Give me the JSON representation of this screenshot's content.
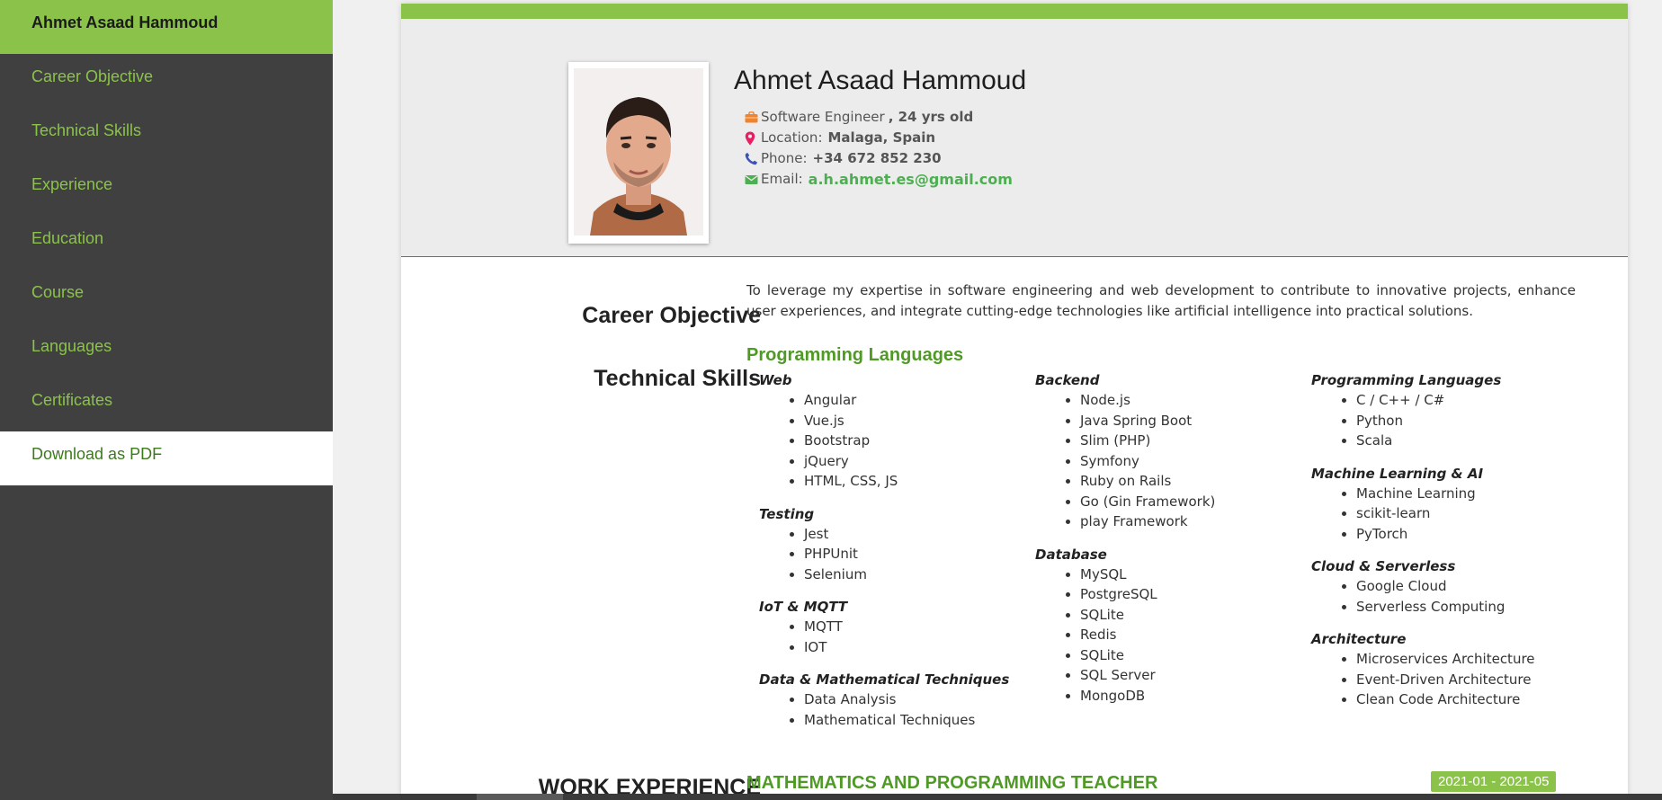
{
  "sidebar": {
    "items": [
      {
        "label": "Ahmet Asaad Hammoud"
      },
      {
        "label": "Career Objective"
      },
      {
        "label": "Technical Skills"
      },
      {
        "label": "Experience"
      },
      {
        "label": "Education"
      },
      {
        "label": "Course"
      },
      {
        "label": "Languages"
      },
      {
        "label": "Certificates"
      },
      {
        "label": "Download as PDF"
      }
    ]
  },
  "profile": {
    "name": "Ahmet Asaad Hammoud",
    "job": "Software Engineer",
    "age": ", 24 yrs old",
    "location_label": "Location:",
    "location": "Malaga, Spain",
    "phone_label": "Phone:",
    "phone": "+34 672 852 230",
    "email_label": "Email:",
    "email": "a.h.ahmet.es@gmail.com"
  },
  "sections": {
    "career_title": "Career Objective",
    "career_text": "To leverage my expertise in software engineering and web development to contribute to innovative projects, enhance user experiences, and integrate cutting-edge technologies like artificial intelligence into practical solutions.",
    "skills_title": "Technical Skills",
    "skills_sub": "Programming Languages",
    "work_title": "WORK EXPERIENCE",
    "job_title": "MATHEMATICS AND PROGRAMMING TEACHER",
    "job_dates": "2021-01 - 2021-05"
  },
  "skills": {
    "col1": [
      {
        "title": "Web",
        "items": [
          "Angular",
          "Vue.js",
          "Bootstrap",
          "jQuery",
          "HTML, CSS, JS"
        ]
      },
      {
        "title": "Testing",
        "items": [
          "Jest",
          "PHPUnit",
          "Selenium"
        ]
      },
      {
        "title": "IoT & MQTT",
        "items": [
          "MQTT",
          "IOT"
        ]
      },
      {
        "title": "Data & Mathematical Techniques",
        "items": [
          "Data Analysis",
          "Mathematical Techniques"
        ]
      }
    ],
    "col2": [
      {
        "title": "Backend",
        "items": [
          "Node.js",
          "Java Spring Boot",
          "Slim (PHP)",
          "Symfony",
          "Ruby on Rails",
          "Go (Gin Framework)",
          "play Framework"
        ]
      },
      {
        "title": "Database",
        "items": [
          "MySQL",
          "PostgreSQL",
          "SQLite",
          "Redis",
          "SQLite",
          "SQL Server",
          "MongoDB"
        ]
      }
    ],
    "col3": [
      {
        "title": "Programming Languages",
        "items": [
          "C / C++ / C#",
          "Python",
          "Scala"
        ]
      },
      {
        "title": "Machine Learning & AI",
        "items": [
          "Machine Learning",
          "scikit-learn",
          "PyTorch"
        ]
      },
      {
        "title": "Cloud & Serverless",
        "items": [
          "Google Cloud",
          "Serverless Computing"
        ]
      },
      {
        "title": "Architecture",
        "items": [
          "Microservices Architecture",
          "Event-Driven Architecture",
          "Clean Code Architecture"
        ]
      }
    ]
  },
  "colors": {
    "accent": "#8bc34a",
    "sidebar_bg": "#404040",
    "link_green": "#4caf50",
    "heading_green": "#4f9a25"
  },
  "icons": {
    "job": "briefcase-icon",
    "location": "map-pin-icon",
    "phone": "phone-icon",
    "email": "envelope-icon"
  }
}
